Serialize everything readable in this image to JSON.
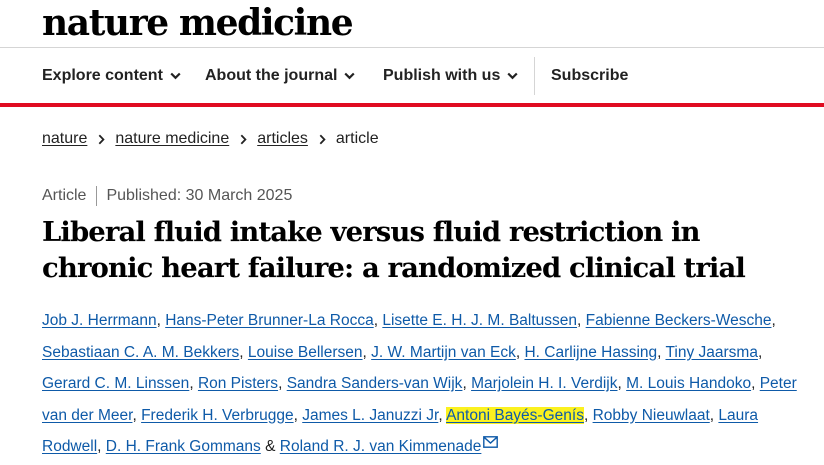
{
  "site": {
    "logo": "nature medicine"
  },
  "nav": {
    "items": [
      {
        "label": "Explore content"
      },
      {
        "label": "About the journal"
      },
      {
        "label": "Publish with us"
      },
      {
        "label": "Subscribe"
      }
    ]
  },
  "breadcrumb": [
    "nature",
    "nature medicine",
    "articles",
    "article"
  ],
  "article": {
    "type": "Article",
    "published": "Published: 30 March 2025",
    "title": "Liberal fluid intake versus fluid restriction in chronic heart failure: a randomized clinical trial"
  },
  "authors": {
    "names": [
      "Job J. Herrmann",
      "Hans-Peter Brunner-La Rocca",
      "Lisette E. H. J. M. Baltussen",
      "Fabienne Beckers-Wesche",
      "Sebastiaan C. A. M. Bekkers",
      "Louise Bellersen",
      "J. W. Martijn van Eck",
      "H. Carlijne Hassing",
      "Tiny Jaarsma",
      "Gerard C. M. Linssen",
      "Ron Pisters",
      "Sandra Sanders-van Wijk",
      "Marjolein H. I. Verdijk",
      "M. Louis Handoko",
      "Peter van der Meer",
      "Frederik H. Verbrugge",
      "James L. Januzzi Jr",
      "Antoni Bayés-Genís",
      "Robby Nieuwlaat",
      "Laura Rodwell",
      "D. H. Frank Gommans",
      "Roland R. J. van Kimmenade"
    ],
    "highlighted": "Antoni Bayés-Genís",
    "separator": ",",
    "final_joiner": "&",
    "corresponding_icon": "envelope-icon"
  },
  "colors": {
    "accent_rule": "#e00b21",
    "author_link": "#0e5aa8",
    "highlight": "#fbf11f"
  }
}
